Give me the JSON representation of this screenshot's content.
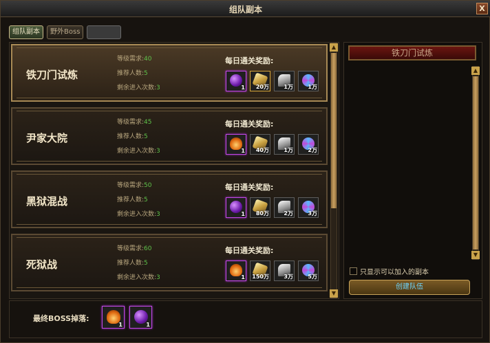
{
  "window": {
    "title": "组队副本",
    "close_label": "X"
  },
  "tabs": [
    {
      "label": "组队副本",
      "active": true
    },
    {
      "label": "野外Boss",
      "active": false
    },
    {
      "label": "",
      "active": false
    }
  ],
  "entries": [
    {
      "name": "铁刀门试炼",
      "level_label": "等级需求:",
      "level": "40",
      "players_label": "推荐人数:",
      "players": "5",
      "entries_label": "剩余进入次数:",
      "entries_left": "3",
      "reward_label": "每日通关奖励:",
      "selected": true,
      "rewards": [
        {
          "icon": "purple-orb-icon",
          "count": "1"
        },
        {
          "icon": "gold-ingot-icon",
          "count": "20万"
        },
        {
          "icon": "silver-wing-icon",
          "count": "1万"
        },
        {
          "icon": "blue-swirl-icon",
          "count": "1万"
        }
      ]
    },
    {
      "name": "尹家大院",
      "level_label": "等级需求:",
      "level": "45",
      "players_label": "推荐人数:",
      "players": "5",
      "entries_label": "剩余进入次数:",
      "entries_left": "3",
      "reward_label": "每日通关奖励:",
      "selected": false,
      "rewards": [
        {
          "icon": "flame-orb-icon",
          "count": "1"
        },
        {
          "icon": "gold-ingot-icon",
          "count": "40万"
        },
        {
          "icon": "silver-wing-icon",
          "count": "1万"
        },
        {
          "icon": "blue-swirl-icon",
          "count": "2万"
        }
      ]
    },
    {
      "name": "黑狱混战",
      "level_label": "等级需求:",
      "level": "50",
      "players_label": "推荐人数:",
      "players": "5",
      "entries_label": "剩余进入次数:",
      "entries_left": "3",
      "reward_label": "每日通关奖励:",
      "selected": false,
      "rewards": [
        {
          "icon": "purple-orb-icon",
          "count": "1"
        },
        {
          "icon": "gold-ingot-icon",
          "count": "80万"
        },
        {
          "icon": "silver-wing-icon",
          "count": "2万"
        },
        {
          "icon": "blue-swirl-icon",
          "count": "3万"
        }
      ]
    },
    {
      "name": "死狱战",
      "level_label": "等级需求:",
      "level": "60",
      "players_label": "推荐人数:",
      "players": "5",
      "entries_label": "剩余进入次数:",
      "entries_left": "3",
      "reward_label": "每日通关奖励:",
      "selected": false,
      "rewards": [
        {
          "icon": "flame-orb-icon",
          "count": "1"
        },
        {
          "icon": "gold-ingot-icon",
          "count": "150万"
        },
        {
          "icon": "silver-wing-icon",
          "count": "3万"
        },
        {
          "icon": "blue-swirl-icon",
          "count": "5万"
        }
      ]
    }
  ],
  "right_panel": {
    "header": "铁刀门试炼",
    "checkbox_label": "只显示可以加入的副本",
    "create_button": "创建队伍"
  },
  "boss_drop": {
    "label": "最终BOSS掉落:",
    "items": [
      {
        "icon": "flame-orb-icon",
        "count": "1"
      },
      {
        "icon": "purple-orb-icon",
        "count": "1"
      }
    ]
  },
  "colors": {
    "level_value": "#5fc24a",
    "purple_border": "#c248e6",
    "gold_border": "#d9a83a",
    "button_text": "#6ed6ff"
  }
}
